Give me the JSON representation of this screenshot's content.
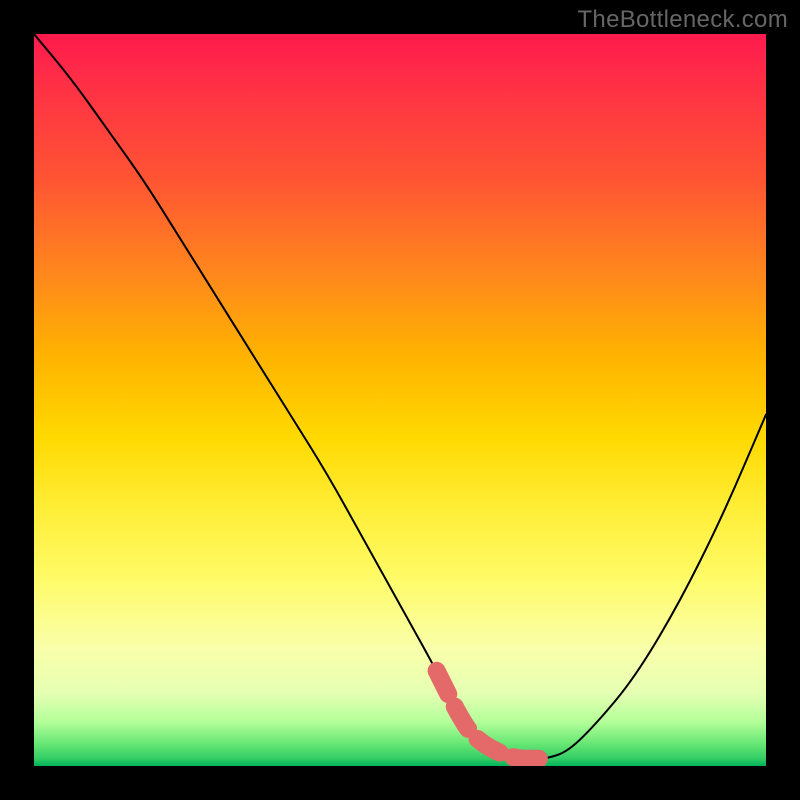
{
  "watermark": "TheBottleneck.com",
  "chart_data": {
    "type": "line",
    "title": "",
    "xlabel": "",
    "ylabel": "",
    "xlim": [
      0,
      100
    ],
    "ylim": [
      0,
      100
    ],
    "series": [
      {
        "name": "bottleneck-curve",
        "x": [
          0,
          5,
          10,
          15,
          20,
          25,
          30,
          35,
          40,
          45,
          50,
          55,
          58,
          60,
          63,
          66,
          68,
          70,
          73,
          77,
          82,
          88,
          94,
          100
        ],
        "values": [
          100,
          94,
          87,
          80,
          72,
          64,
          56,
          48,
          40,
          31,
          22,
          13,
          7,
          4,
          2,
          1,
          1,
          1,
          2,
          6,
          12,
          22,
          34,
          48
        ]
      }
    ],
    "highlight_band": {
      "name": "optimal-range",
      "color": "#e46a6a",
      "x_start": 55,
      "x_end": 72
    },
    "background_gradient": [
      "#ff1a4d",
      "#ff8c1a",
      "#ffd900",
      "#fffb66",
      "#33cc66"
    ]
  }
}
